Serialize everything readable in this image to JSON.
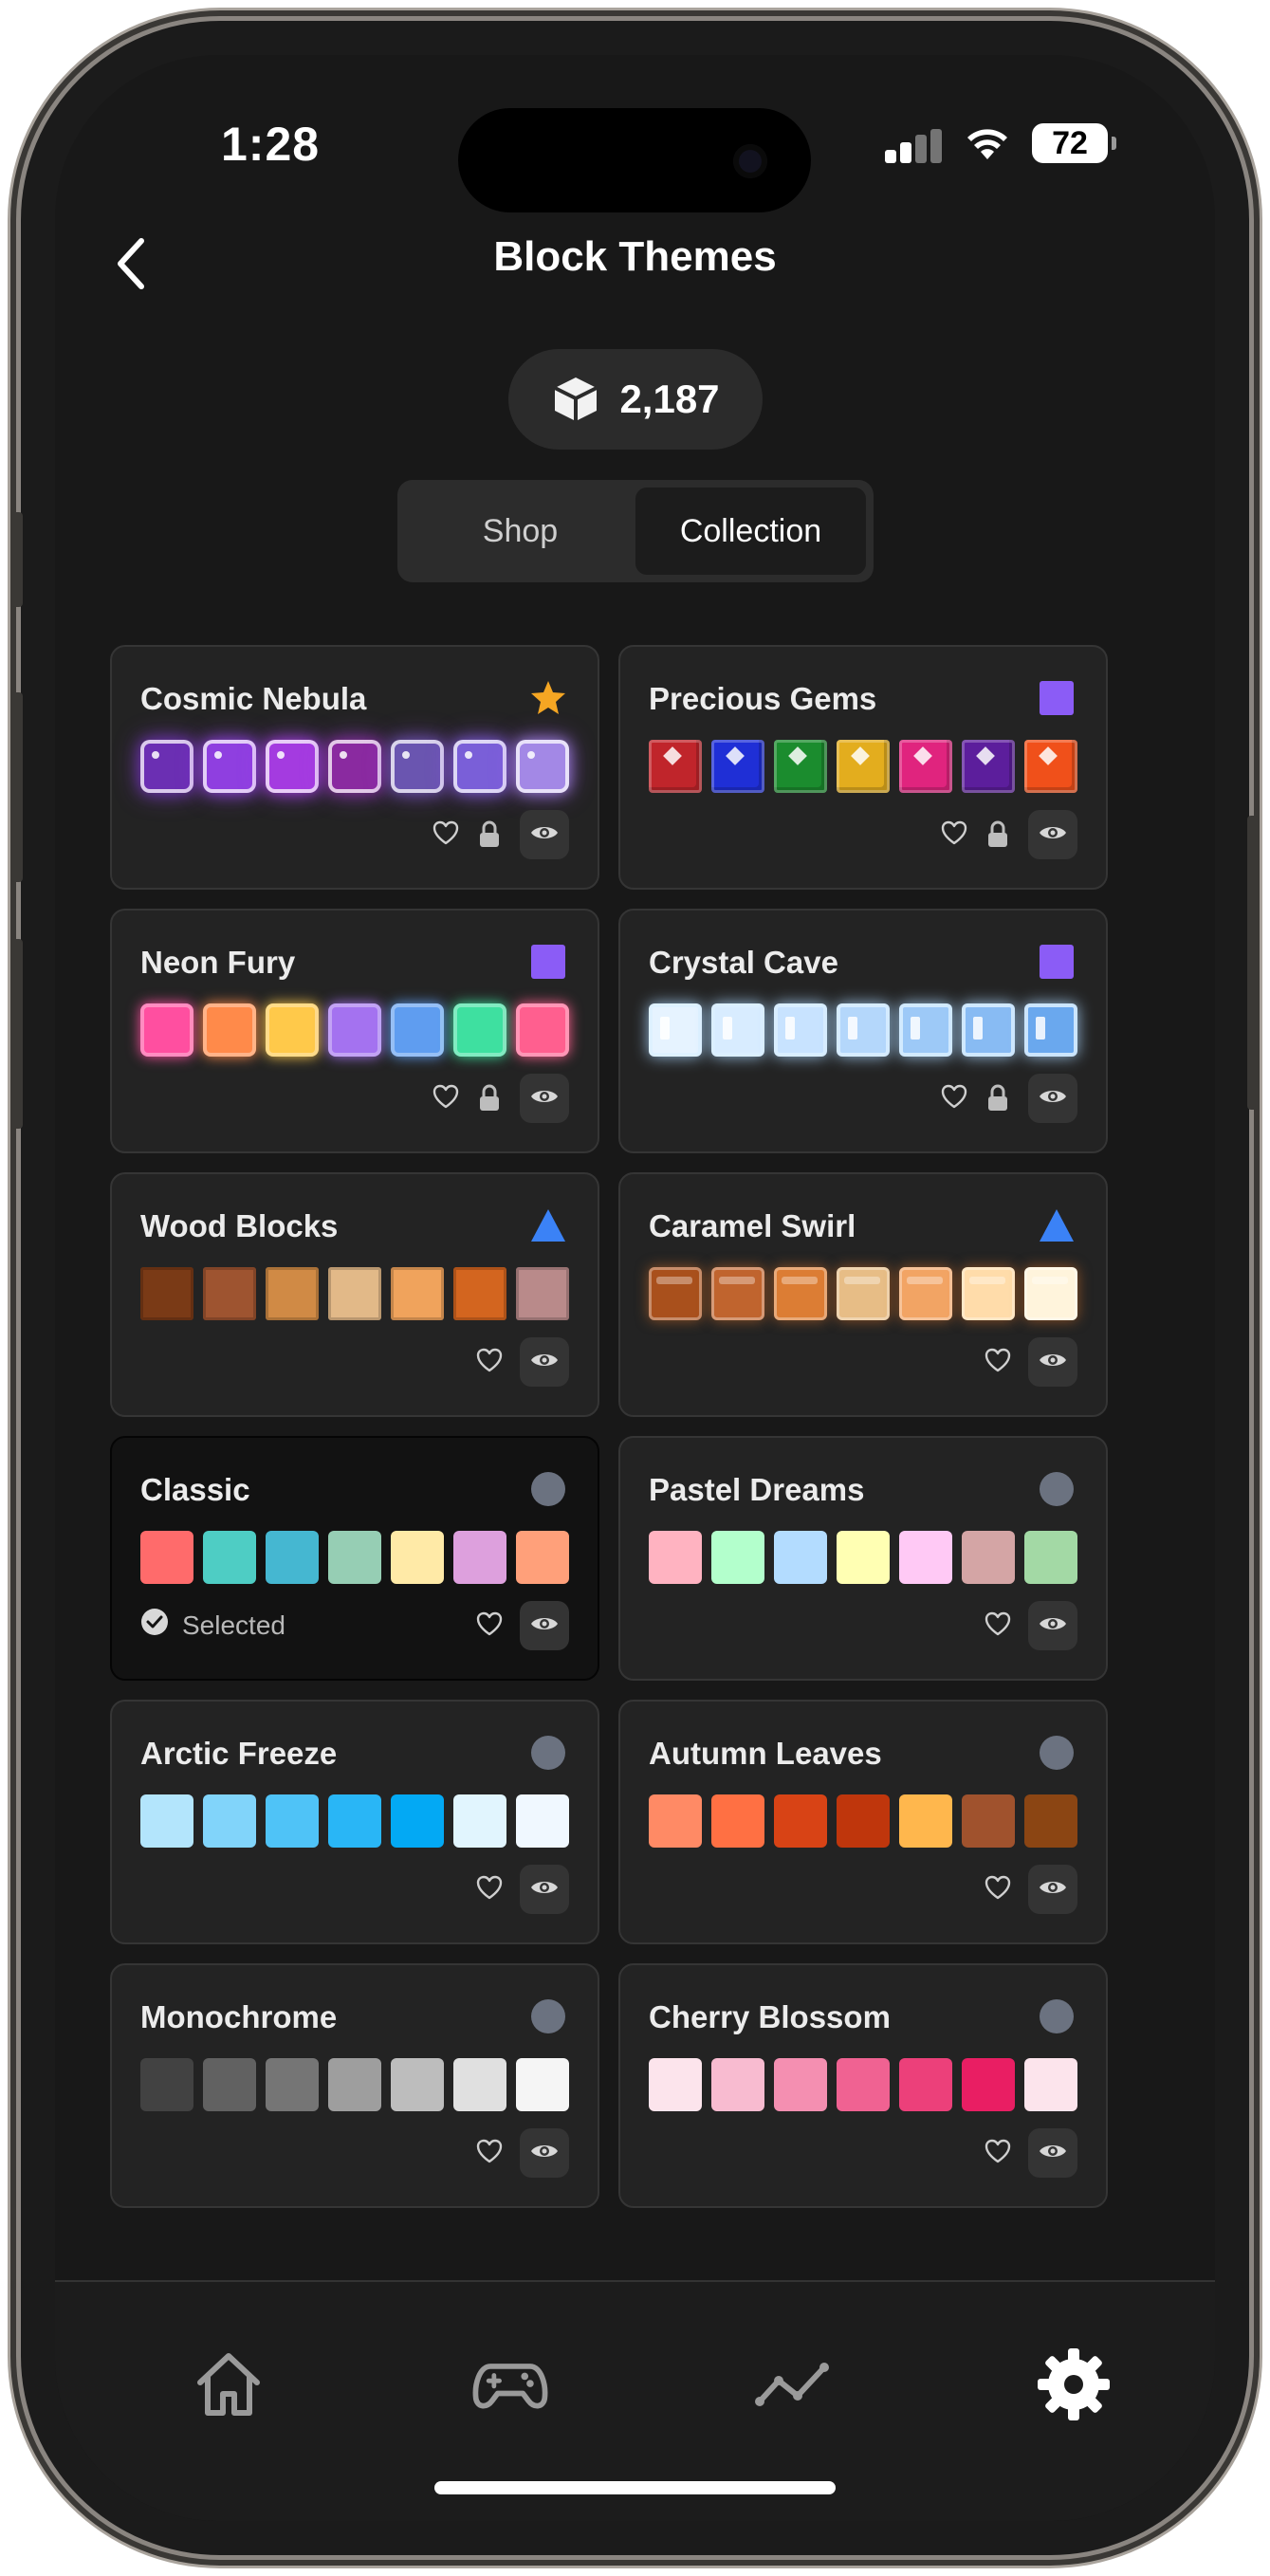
{
  "status_bar": {
    "time": "1:28",
    "battery": "72"
  },
  "header": {
    "title": "Block Themes",
    "coins": "2,187"
  },
  "tabs": [
    {
      "label": "Shop",
      "active": false
    },
    {
      "label": "Collection",
      "active": true
    }
  ],
  "selected_label": "Selected",
  "themes": [
    {
      "name": "Cosmic Nebula",
      "badge": "star-icon",
      "locked": true,
      "style": "glow",
      "colors": [
        "#6b2fb3",
        "#8f3fe0",
        "#a43be0",
        "#8a2aa0",
        "#6a55b0",
        "#7a5fd8",
        "#a388e6"
      ]
    },
    {
      "name": "Precious Gems",
      "badge": "purple-square-icon",
      "locked": true,
      "style": "gem",
      "colors": [
        "#c0252b",
        "#1f2fd6",
        "#1b8c2e",
        "#e3ad1e",
        "#e0247e",
        "#5c1e9c",
        "#f0501a"
      ]
    },
    {
      "name": "Neon Fury",
      "badge": "purple-square-icon",
      "locked": true,
      "style": "neon",
      "colors": [
        "#ff4fa0",
        "#ff8a4a",
        "#ffc94a",
        "#a472f0",
        "#5f9df0",
        "#3ee0a0",
        "#ff5f8f"
      ]
    },
    {
      "name": "Crystal Cave",
      "badge": "purple-square-icon",
      "locked": true,
      "style": "ice",
      "colors": [
        "#e6f3ff",
        "#d8ecff",
        "#c8e3ff",
        "#b4d7fb",
        "#9dc9f7",
        "#88bbf3",
        "#6aa8ee"
      ]
    },
    {
      "name": "Wood Blocks",
      "badge": "blue-triangle-icon",
      "locked": false,
      "style": "wood",
      "colors": [
        "#7a3a16",
        "#9e5430",
        "#d08a45",
        "#e2b988",
        "#f0a35c",
        "#d3651f",
        "#b98a8a"
      ]
    },
    {
      "name": "Caramel Swirl",
      "badge": "blue-triangle-icon",
      "locked": false,
      "style": "caramel",
      "colors": [
        "#a9501c",
        "#c0642e",
        "#dc7d34",
        "#e7bd86",
        "#f2a464",
        "#ffdcaa",
        "#fff4dc"
      ]
    },
    {
      "name": "Classic",
      "badge": "gray-circle-icon",
      "locked": false,
      "style": "flat",
      "selected": true,
      "colors": [
        "#ff6b6b",
        "#4ecdc4",
        "#45b7d1",
        "#96ceb4",
        "#ffeaa7",
        "#dda0dd",
        "#ffa07a"
      ]
    },
    {
      "name": "Pastel Dreams",
      "badge": "gray-circle-icon",
      "locked": false,
      "style": "flat",
      "colors": [
        "#ffb3c1",
        "#b3ffcc",
        "#b3dcff",
        "#ffffb3",
        "#ffc9f5",
        "#d4a5a5",
        "#a3d9a5"
      ]
    },
    {
      "name": "Arctic Freeze",
      "badge": "gray-circle-icon",
      "locked": false,
      "style": "flat",
      "colors": [
        "#b3e5fc",
        "#81d4fa",
        "#4fc3f7",
        "#29b6f6",
        "#03a9f4",
        "#e1f5fe",
        "#f0f8ff"
      ]
    },
    {
      "name": "Autumn Leaves",
      "badge": "gray-circle-icon",
      "locked": false,
      "style": "flat",
      "colors": [
        "#ff8a65",
        "#ff7043",
        "#d84315",
        "#bf360c",
        "#ffb74d",
        "#a0522d",
        "#8b4513"
      ]
    },
    {
      "name": "Monochrome",
      "badge": "gray-circle-icon",
      "locked": false,
      "style": "flat",
      "colors": [
        "#424242",
        "#616161",
        "#757575",
        "#9e9e9e",
        "#bdbdbd",
        "#e0e0e0",
        "#f5f5f5"
      ]
    },
    {
      "name": "Cherry Blossom",
      "badge": "gray-circle-icon",
      "locked": false,
      "style": "flat",
      "colors": [
        "#fce4ec",
        "#f8bbd0",
        "#f48fb1",
        "#f06292",
        "#ec407a",
        "#e91e63",
        "#fce4ec"
      ]
    }
  ],
  "nav": [
    {
      "icon": "home-icon",
      "active": false
    },
    {
      "icon": "gamepad-icon",
      "active": false
    },
    {
      "icon": "stats-icon",
      "active": false
    },
    {
      "icon": "settings-icon",
      "active": true
    }
  ],
  "colors": {
    "background": "#181818",
    "card": "#232323",
    "star": "#f5a623",
    "square": "#8b5cf6",
    "triangle": "#3b82f6",
    "circle": "#6b7280"
  }
}
